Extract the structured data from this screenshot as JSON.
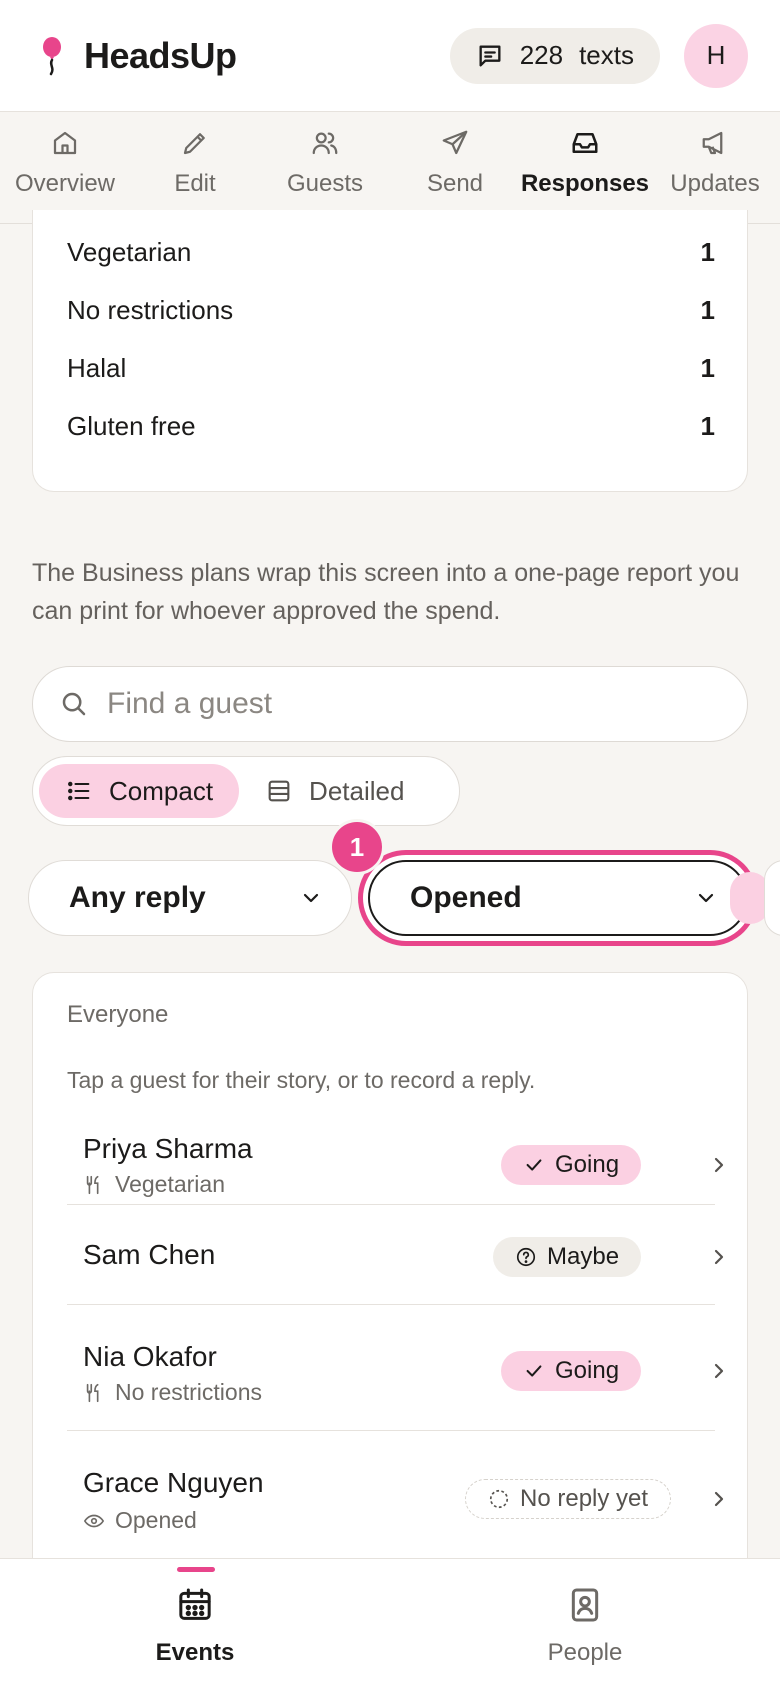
{
  "header": {
    "brand": "HeadsUp",
    "credits_count": "228",
    "credits_unit": "texts",
    "avatar_initial": "H"
  },
  "tabs": [
    {
      "label": "Overview",
      "icon": "home-icon"
    },
    {
      "label": "Edit",
      "icon": "pencil-icon"
    },
    {
      "label": "Guests",
      "icon": "users-icon"
    },
    {
      "label": "Send",
      "icon": "send-icon"
    },
    {
      "label": "Responses",
      "icon": "inbox-icon",
      "active": true
    },
    {
      "label": "Updates",
      "icon": "megaphone-icon"
    }
  ],
  "diet": [
    {
      "label": "Vegetarian",
      "count": "1"
    },
    {
      "label": "No restrictions",
      "count": "1"
    },
    {
      "label": "Halal",
      "count": "1"
    },
    {
      "label": "Gluten free",
      "count": "1"
    }
  ],
  "promo_text": "The Business plans wrap this screen into a one-page report you can print for whoever approved the spend.",
  "search": {
    "placeholder": "Find a guest"
  },
  "view_toggle": {
    "compact": "Compact",
    "detailed": "Detailed",
    "selected": "Compact"
  },
  "filters": {
    "reply": "Any reply",
    "activity": "Opened",
    "badge": "1"
  },
  "list": {
    "title": "Everyone",
    "subtitle": "Tap a guest for their story, or to record a reply.",
    "guests": [
      {
        "name": "Priya Sharma",
        "meta": "Vegetarian",
        "meta_icon": "utensils-icon",
        "status": "Going",
        "status_icon": "check-icon"
      },
      {
        "name": "Sam Chen",
        "meta": "",
        "status": "Maybe",
        "status_icon": "question-circle-icon"
      },
      {
        "name": "Nia Okafor",
        "meta": "No restrictions",
        "meta_icon": "utensils-icon",
        "status": "Going",
        "status_icon": "check-icon"
      },
      {
        "name": "Grace Nguyen",
        "meta": "Opened",
        "meta_icon": "eye-icon",
        "status": "No reply yet",
        "status_icon": "dashed-circle-icon"
      }
    ]
  },
  "bottom_nav": [
    {
      "label": "Events",
      "icon": "calendar-icon",
      "active": true
    },
    {
      "label": "People",
      "icon": "contacts-icon"
    }
  ],
  "colors": {
    "accent": "#e8458b",
    "accent_soft": "#fbd0e2",
    "background": "#f7f5f2"
  }
}
